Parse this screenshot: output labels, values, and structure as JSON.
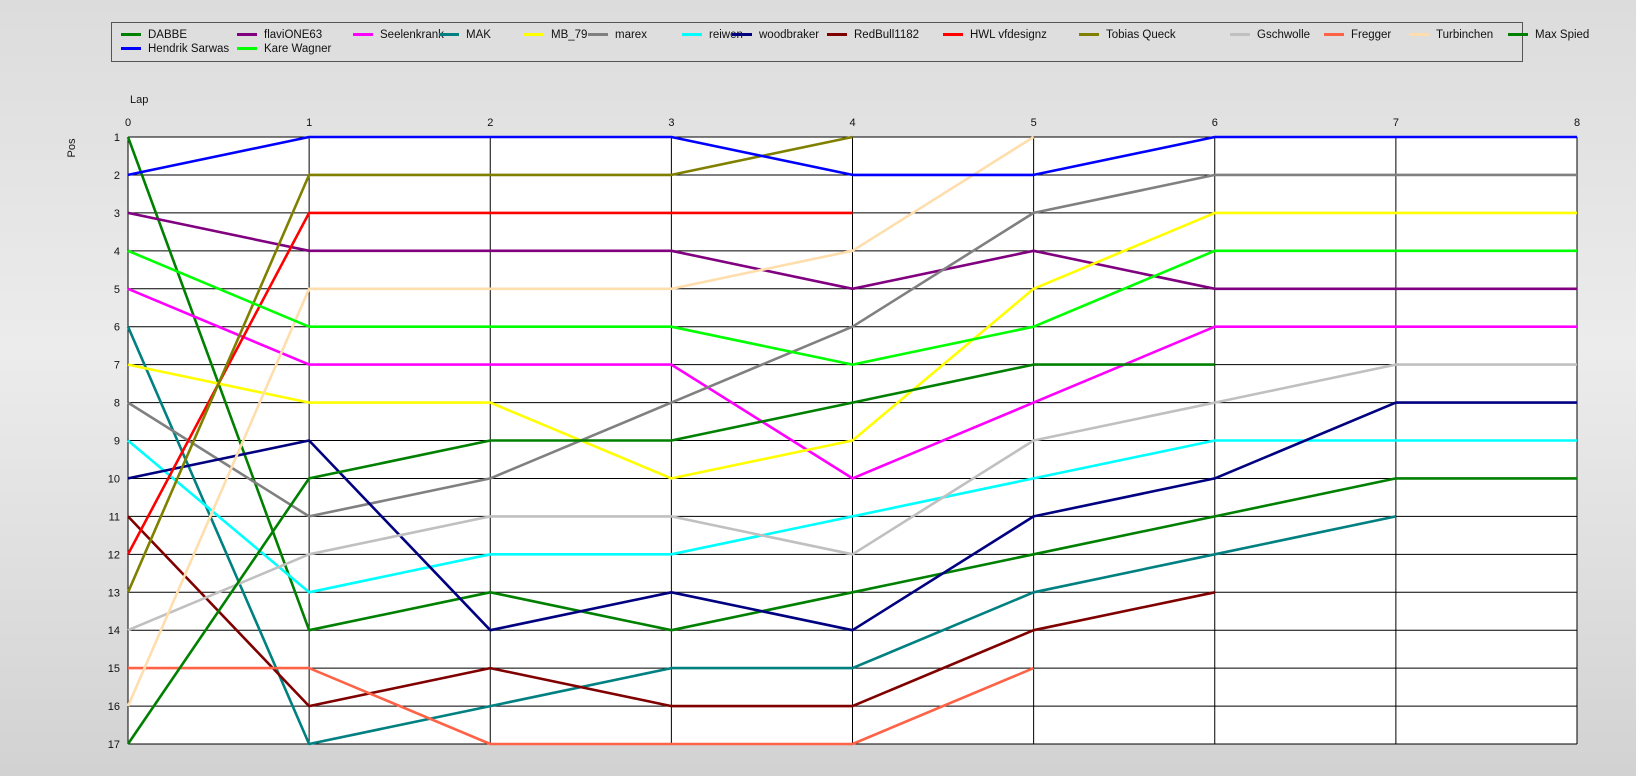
{
  "chart_data": {
    "type": "line",
    "xlabel": "Lap",
    "ylabel": "Pos",
    "x": [
      0,
      1,
      2,
      3,
      4,
      5,
      6,
      7,
      8
    ],
    "xlim": [
      0,
      8
    ],
    "ylim": [
      1,
      17
    ],
    "y_inverted": true,
    "y_ticks": [
      1,
      2,
      3,
      4,
      5,
      6,
      7,
      8,
      9,
      10,
      11,
      12,
      13,
      14,
      15,
      16,
      17
    ],
    "grid": true,
    "legend": "top",
    "series": [
      {
        "name": "DABBE",
        "color": "#008000",
        "values": [
          1,
          14,
          13,
          14,
          13,
          12,
          11,
          10,
          10
        ]
      },
      {
        "name": "flaviONE63",
        "color": "#800080",
        "values": [
          3,
          4,
          4,
          4,
          5,
          4,
          5,
          5,
          5
        ]
      },
      {
        "name": "Seelenkrank",
        "color": "#FF00FF",
        "values": [
          5,
          7,
          7,
          7,
          10,
          8,
          6,
          6,
          6
        ]
      },
      {
        "name": "MAK",
        "color": "#008080",
        "values": [
          6,
          17,
          16,
          15,
          15,
          13,
          12,
          11,
          null
        ]
      },
      {
        "name": "MB_79",
        "color": "#FFFF00",
        "values": [
          7,
          8,
          8,
          10,
          9,
          5,
          3,
          3,
          3
        ]
      },
      {
        "name": "marex",
        "color": "#808080",
        "values": [
          8,
          11,
          10,
          8,
          6,
          3,
          2,
          2,
          2
        ]
      },
      {
        "name": "reiwen",
        "color": "#00FFFF",
        "values": [
          9,
          13,
          12,
          12,
          11,
          10,
          9,
          9,
          9
        ]
      },
      {
        "name": "woodbraker",
        "color": "#000080",
        "values": [
          10,
          9,
          14,
          13,
          14,
          11,
          10,
          8,
          8
        ]
      },
      {
        "name": "RedBull1182",
        "color": "#800000",
        "values": [
          11,
          16,
          15,
          16,
          16,
          14,
          13,
          null,
          null
        ]
      },
      {
        "name": "HWL vfdesignz",
        "color": "#FF0000",
        "values": [
          12,
          3,
          3,
          3,
          3,
          null,
          null,
          null,
          null
        ]
      },
      {
        "name": "Tobias Queck",
        "color": "#808000",
        "values": [
          13,
          2,
          2,
          2,
          1,
          null,
          null,
          null,
          null
        ]
      },
      {
        "name": "Gschwolle",
        "color": "#C0C0C0",
        "values": [
          14,
          12,
          11,
          11,
          12,
          9,
          8,
          7,
          7
        ]
      },
      {
        "name": "Fregger",
        "color": "#FF6347",
        "values": [
          15,
          15,
          17,
          17,
          17,
          15,
          null,
          null,
          null
        ]
      },
      {
        "name": "Turbinchen",
        "color": "#FFDEAD",
        "values": [
          16,
          5,
          5,
          5,
          4,
          1,
          null,
          null,
          null
        ]
      },
      {
        "name": "Max Spied",
        "color": "#008000",
        "values": [
          17,
          10,
          9,
          9,
          8,
          7,
          7,
          null,
          null
        ]
      },
      {
        "name": "Hendrik Sarwas",
        "color": "#0000FF",
        "values": [
          2,
          1,
          1,
          1,
          2,
          2,
          1,
          1,
          1
        ]
      },
      {
        "name": "Kare Wagner",
        "color": "#00FF00",
        "values": [
          4,
          6,
          6,
          6,
          7,
          6,
          4,
          4,
          4
        ]
      }
    ]
  }
}
